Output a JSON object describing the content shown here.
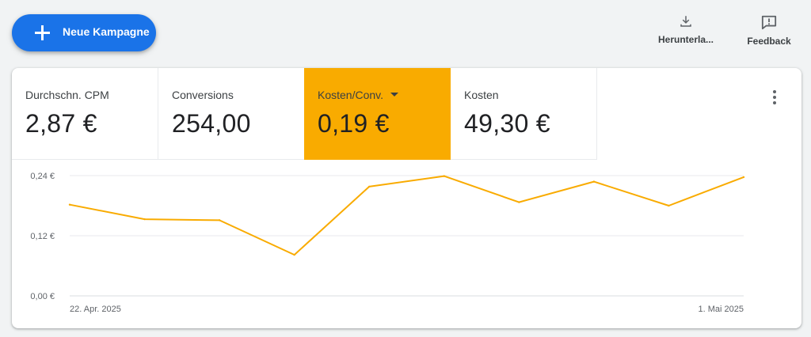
{
  "toolbar": {
    "new_campaign_label": "Neue Kampagne",
    "download_label": "Herunterla...",
    "feedback_label": "Feedback",
    "download_icon": "download-icon",
    "feedback_icon": "feedback-icon",
    "accent_color": "#1a73e8"
  },
  "metrics": [
    {
      "label": "Durchschn. CPM",
      "value": "2,87 €"
    },
    {
      "label": "Conversions",
      "value": "254,00"
    },
    {
      "label": "Kosten/Conv.",
      "value": "0,19 €",
      "selected": true,
      "color": "#f9ab00"
    },
    {
      "label": "Kosten",
      "value": "49,30 €"
    }
  ],
  "chart_data": {
    "type": "line",
    "series": [
      {
        "values": [
          0.182,
          0.153,
          0.151,
          0.082,
          0.218,
          0.239,
          0.187,
          0.228,
          0.18,
          0.237
        ],
        "color": "#f9ab00"
      }
    ],
    "x_tick_labels": [
      "22. Apr. 2025",
      "1. Mai 2025"
    ],
    "y_ticks": [
      {
        "value": 0.24,
        "label": "0,24 €"
      },
      {
        "value": 0.12,
        "label": "0,12 €"
      },
      {
        "value": 0.0,
        "label": "0,00 €"
      }
    ],
    "ylim": [
      0,
      0.24
    ],
    "grid": true
  }
}
